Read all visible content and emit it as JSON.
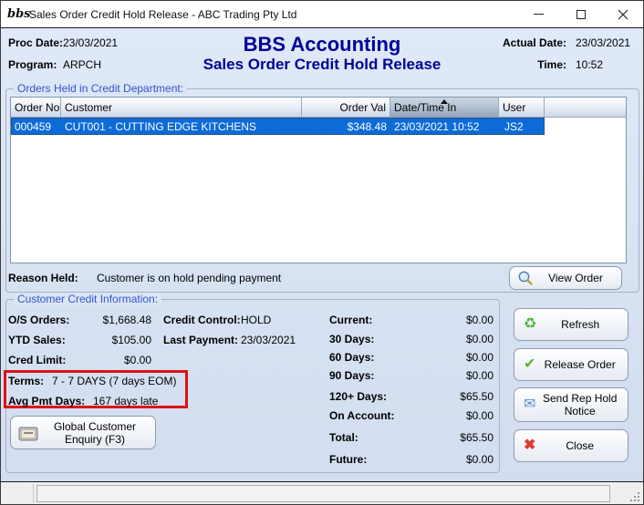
{
  "window": {
    "logo_text": "bbs",
    "title": "Sales Order Credit Hold Release - ABC Trading Pty Ltd"
  },
  "header": {
    "proc_date_label": "Proc Date:",
    "proc_date": "23/03/2021",
    "program_label": "Program:",
    "program": "ARPCH",
    "app_title": "BBS Accounting",
    "screen_title": "Sales Order Credit Hold Release",
    "actual_date_label": "Actual Date:",
    "actual_date": "23/03/2021",
    "time_label": "Time:",
    "time": "10:52"
  },
  "orders_section": {
    "title": "Orders Held in Credit Department:",
    "columns": {
      "order_no": "Order No",
      "customer": "Customer",
      "order_val": "Order Val",
      "date_time_in": "Date/Time In",
      "user": "User"
    },
    "sorted_column": "date_time_in",
    "rows": [
      {
        "order_no": "000459",
        "customer": "CUT001 - CUTTING EDGE KITCHENS",
        "order_val": "$348.48",
        "date_time_in": "23/03/2021 10:52",
        "user": "JS2"
      }
    ],
    "reason_held_label": "Reason Held:",
    "reason_held": "Customer is on hold pending payment",
    "view_order_button": "View Order"
  },
  "credit_info": {
    "title": "Customer Credit Information:",
    "left": [
      {
        "label": "O/S Orders:",
        "value": "$1,668.48"
      },
      {
        "label": "YTD Sales:",
        "value": "$105.00"
      },
      {
        "label": "Cred Limit:",
        "value": "$0.00"
      }
    ],
    "mid": [
      {
        "label": "Credit Control:",
        "value": "HOLD"
      },
      {
        "label": "Last Payment:",
        "value": "23/03/2021"
      }
    ],
    "highlight": [
      {
        "label": "Terms:",
        "value": "7 - 7 DAYS (7 days EOM)"
      },
      {
        "label": "Avg Pmt Days:",
        "value": "167 days late"
      }
    ],
    "aging": [
      {
        "label": "Current:",
        "value": "$0.00"
      },
      {
        "label": "30 Days:",
        "value": "$0.00"
      },
      {
        "label": "60 Days:",
        "value": "$0.00"
      },
      {
        "label": "90 Days:",
        "value": "$0.00"
      },
      {
        "label": "120+ Days:",
        "value": "$65.50"
      },
      {
        "label": "On Account:",
        "value": "$0.00"
      },
      {
        "label": "Total:",
        "value": "$65.50"
      },
      {
        "label": "Future:",
        "value": "$0.00"
      }
    ]
  },
  "actions": {
    "refresh": "Refresh",
    "release_order": "Release Order",
    "send_rep_hold_notice": "Send Rep Hold Notice",
    "close": "Close",
    "global_customer_enquiry": "Global Customer Enquiry (F3)"
  },
  "icons": {
    "refresh_glyph": "♻",
    "check_glyph": "✔",
    "mail_glyph": "✉",
    "close_glyph": "✖"
  },
  "colors": {
    "heading_navy": "#000099",
    "group_label_blue": "#3355cc",
    "selected_row_blue": "#0d6bd7",
    "highlight_red": "#de1212"
  }
}
